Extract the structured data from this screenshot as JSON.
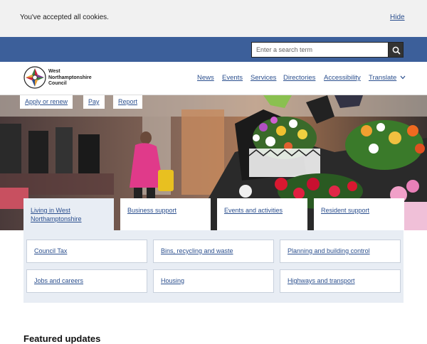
{
  "cookie": {
    "message": "You've accepted all cookies.",
    "hide_label": "Hide"
  },
  "search": {
    "placeholder": "Enter a search term",
    "icon": "search-icon"
  },
  "brand": {
    "line1": "West",
    "line2": "Northamptonshire",
    "line3": "Council"
  },
  "nav": {
    "items": [
      "News",
      "Events",
      "Services",
      "Directories",
      "Accessibility"
    ],
    "translate": "Translate"
  },
  "quick_links": [
    "Apply or renew",
    "Pay",
    "Report"
  ],
  "tabs": [
    {
      "label": "Living in West Northamptonshire",
      "active": true
    },
    {
      "label": "Business support",
      "active": false
    },
    {
      "label": "Events and activities",
      "active": false
    },
    {
      "label": "Resident support",
      "active": false
    }
  ],
  "links": [
    "Council Tax",
    "Bins, recycling and waste",
    "Planning and building control",
    "Jobs and careers",
    "Housing",
    "Highways and transport"
  ],
  "featured": {
    "heading": "Featured updates"
  },
  "colors": {
    "primary_blue": "#3c5f9a",
    "link_blue": "#2b4f8e",
    "panel_bg": "#e8edf4",
    "cookie_bg": "#f1f1f1"
  }
}
